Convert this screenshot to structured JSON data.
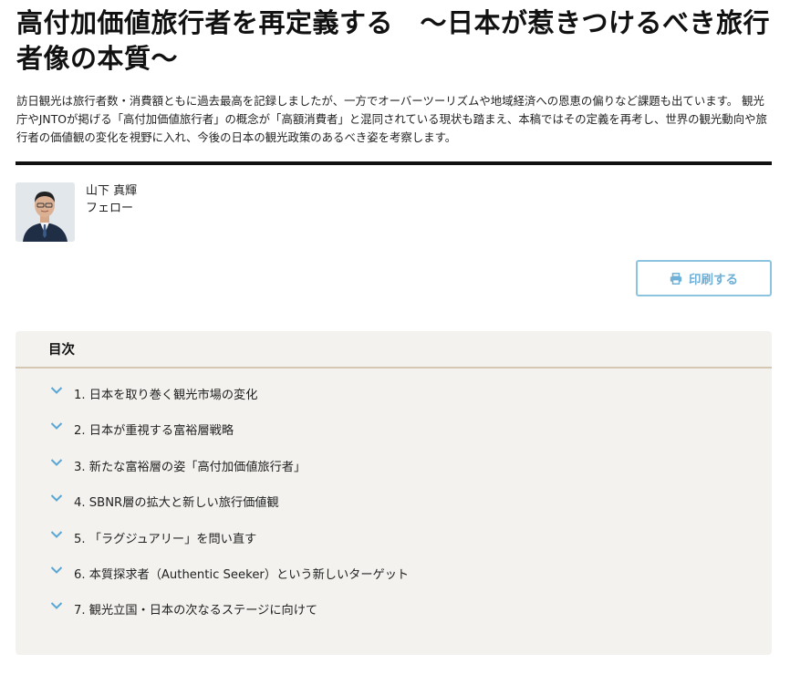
{
  "article": {
    "title": "高付加価値旅行者を再定義する　〜日本が惹きつけるべき旅行者像の本質〜",
    "lead": "訪日観光は旅行者数・消費額ともに過去最高を記録しましたが、一方でオーバーツーリズムや地域経済への恩恵の偏りなど課題も出ています。 観光庁やJNTOが掲げる「高付加価値旅行者」の概念が「高額消費者」と混同されている現状も踏まえ、本稿ではその定義を再考し、世界の観光動向や旅行者の価値観の変化を視野に入れ、今後の日本の観光政策のあるべき姿を考察します。"
  },
  "author": {
    "name": "山下 真輝",
    "role": "フェロー"
  },
  "print": {
    "label": "印刷する",
    "icon": "printer-icon"
  },
  "toc": {
    "heading": "目次",
    "items": [
      {
        "label": "1. 日本を取り巻く観光市場の変化"
      },
      {
        "label": "2. 日本が重視する富裕層戦略"
      },
      {
        "label": "3. 新たな富裕層の姿「高付加価値旅行者」"
      },
      {
        "label": "4. SBNR層の拡大と新しい旅行価値観"
      },
      {
        "label": "5. 「ラグジュアリー」を問い直す"
      },
      {
        "label": "6. 本質探求者（Authentic Seeker）という新しいターゲット"
      },
      {
        "label": "7. 観光立国・日本の次なるステージに向けて"
      }
    ]
  },
  "colors": {
    "accent": "#6fb0d6",
    "chevron": "#5aa6d4",
    "toc_background": "#f3f2ef",
    "toc_divider": "#d5c7b2"
  }
}
